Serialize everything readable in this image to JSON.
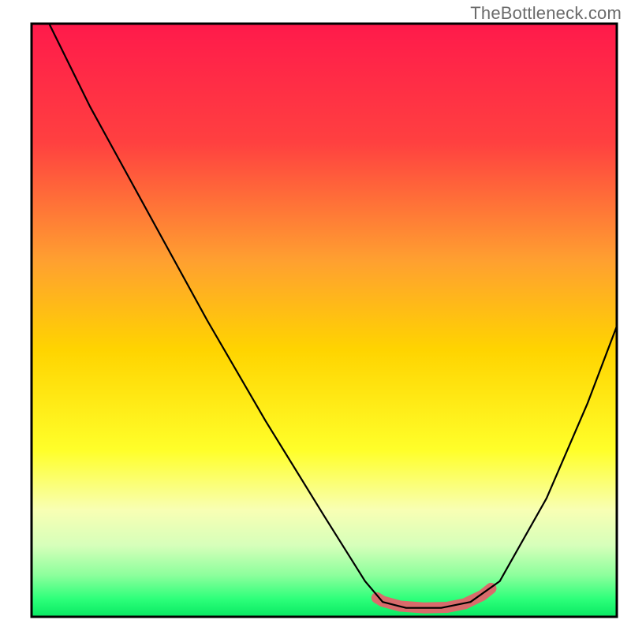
{
  "watermark": "TheBottleneck.com",
  "chart_data": {
    "type": "line",
    "title": "",
    "xlabel": "",
    "ylabel": "",
    "xlim": [
      0,
      100
    ],
    "ylim": [
      0,
      100
    ],
    "gradient_stops": [
      {
        "offset": 0,
        "color": "#ff1a4b"
      },
      {
        "offset": 20,
        "color": "#ff4040"
      },
      {
        "offset": 40,
        "color": "#ffa030"
      },
      {
        "offset": 55,
        "color": "#ffd400"
      },
      {
        "offset": 72,
        "color": "#ffff2a"
      },
      {
        "offset": 82,
        "color": "#f8ffb4"
      },
      {
        "offset": 88,
        "color": "#d6ffba"
      },
      {
        "offset": 93,
        "color": "#8cff9c"
      },
      {
        "offset": 97,
        "color": "#2dff7a"
      },
      {
        "offset": 100,
        "color": "#08e862"
      }
    ],
    "series": [
      {
        "name": "bottleneck-curve",
        "stroke": "#000000",
        "points": [
          {
            "x": 3,
            "y": 100
          },
          {
            "x": 10,
            "y": 86
          },
          {
            "x": 20,
            "y": 68
          },
          {
            "x": 30,
            "y": 50
          },
          {
            "x": 40,
            "y": 33
          },
          {
            "x": 50,
            "y": 17
          },
          {
            "x": 57,
            "y": 6
          },
          {
            "x": 60,
            "y": 2.5
          },
          {
            "x": 64,
            "y": 1.5
          },
          {
            "x": 70,
            "y": 1.5
          },
          {
            "x": 75,
            "y": 2.5
          },
          {
            "x": 80,
            "y": 6
          },
          {
            "x": 88,
            "y": 20
          },
          {
            "x": 95,
            "y": 36
          },
          {
            "x": 100,
            "y": 49
          }
        ]
      },
      {
        "name": "optimal-band",
        "stroke": "#d96b6b",
        "width": 14,
        "points": [
          {
            "x": 59,
            "y": 3.2
          },
          {
            "x": 60,
            "y": 2.6
          },
          {
            "x": 63,
            "y": 1.8
          },
          {
            "x": 67,
            "y": 1.5
          },
          {
            "x": 71,
            "y": 1.6
          },
          {
            "x": 74,
            "y": 2.2
          },
          {
            "x": 77,
            "y": 3.6
          },
          {
            "x": 78.5,
            "y": 4.8
          }
        ]
      }
    ]
  }
}
